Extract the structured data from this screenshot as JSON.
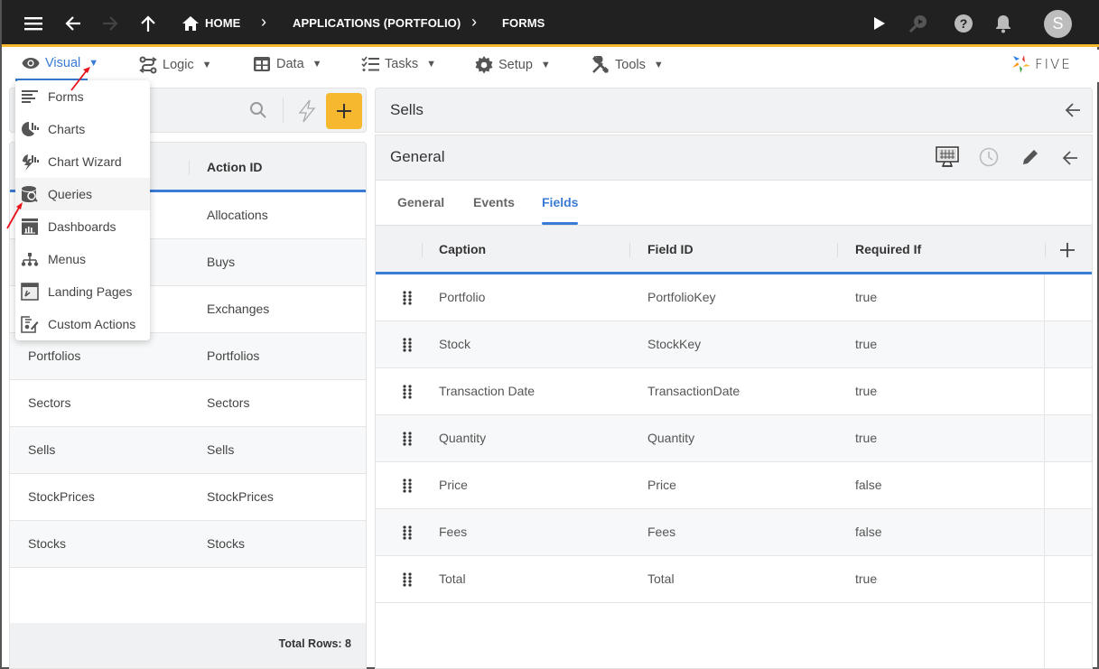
{
  "topbar": {
    "breadcrumbs": [
      "HOME",
      "APPLICATIONS (PORTFOLIO)",
      "FORMS"
    ],
    "avatar_initial": "S",
    "icons": [
      "hamburger-menu-icon",
      "back-arrow-icon",
      "forward-arrow-icon",
      "up-arrow-icon",
      "home-icon",
      "play-icon",
      "search-run-icon",
      "help-icon",
      "bell-icon"
    ]
  },
  "menubar": {
    "items": [
      {
        "label": "Visual",
        "icon": "eye-icon",
        "active": true
      },
      {
        "label": "Logic",
        "icon": "logic-icon"
      },
      {
        "label": "Data",
        "icon": "table-icon"
      },
      {
        "label": "Tasks",
        "icon": "checklist-icon"
      },
      {
        "label": "Setup",
        "icon": "gear-icon"
      },
      {
        "label": "Tools",
        "icon": "tools-icon"
      }
    ],
    "caret": "▼",
    "logo_text": "FIVE"
  },
  "dropdown": {
    "items": [
      {
        "label": "Forms",
        "icon": "forms-icon"
      },
      {
        "label": "Charts",
        "icon": "chart-icon"
      },
      {
        "label": "Chart Wizard",
        "icon": "chart-wizard-icon"
      },
      {
        "label": "Queries",
        "icon": "query-icon",
        "highlighted": true
      },
      {
        "label": "Dashboards",
        "icon": "dashboard-icon"
      },
      {
        "label": "Menus",
        "icon": "menu-tree-icon"
      },
      {
        "label": "Landing Pages",
        "icon": "landing-page-icon"
      },
      {
        "label": "Custom Actions",
        "icon": "custom-action-icon"
      }
    ]
  },
  "left_panel": {
    "column_header": "Action ID",
    "rows": [
      {
        "name": "",
        "action_id": "Allocations"
      },
      {
        "name": "",
        "action_id": "Buys"
      },
      {
        "name": "",
        "action_id": "Exchanges"
      },
      {
        "name": "Portfolios",
        "action_id": "Portfolios"
      },
      {
        "name": "Sectors",
        "action_id": "Sectors"
      },
      {
        "name": "Sells",
        "action_id": "Sells"
      },
      {
        "name": "StockPrices",
        "action_id": "StockPrices"
      },
      {
        "name": "Stocks",
        "action_id": "Stocks"
      }
    ],
    "footer": "Total Rows: 8"
  },
  "right_panel": {
    "title": "Sells",
    "section_title": "General",
    "tabs": [
      {
        "label": "General"
      },
      {
        "label": "Events"
      },
      {
        "label": "Fields",
        "active": true
      }
    ],
    "fields_table": {
      "headers": [
        "Caption",
        "Field ID",
        "Required If"
      ],
      "rows": [
        {
          "caption": "Portfolio",
          "field_id": "PortfolioKey",
          "required_if": "true"
        },
        {
          "caption": "Stock",
          "field_id": "StockKey",
          "required_if": "true"
        },
        {
          "caption": "Transaction Date",
          "field_id": "TransactionDate",
          "required_if": "true"
        },
        {
          "caption": "Quantity",
          "field_id": "Quantity",
          "required_if": "true"
        },
        {
          "caption": "Price",
          "field_id": "Price",
          "required_if": "false"
        },
        {
          "caption": "Fees",
          "field_id": "Fees",
          "required_if": "false"
        },
        {
          "caption": "Total",
          "field_id": "Total",
          "required_if": "true"
        }
      ]
    }
  },
  "colors": {
    "accent": "#3a7bd5",
    "brand_yellow": "#f5b82e",
    "topbar_bg": "#212121"
  }
}
